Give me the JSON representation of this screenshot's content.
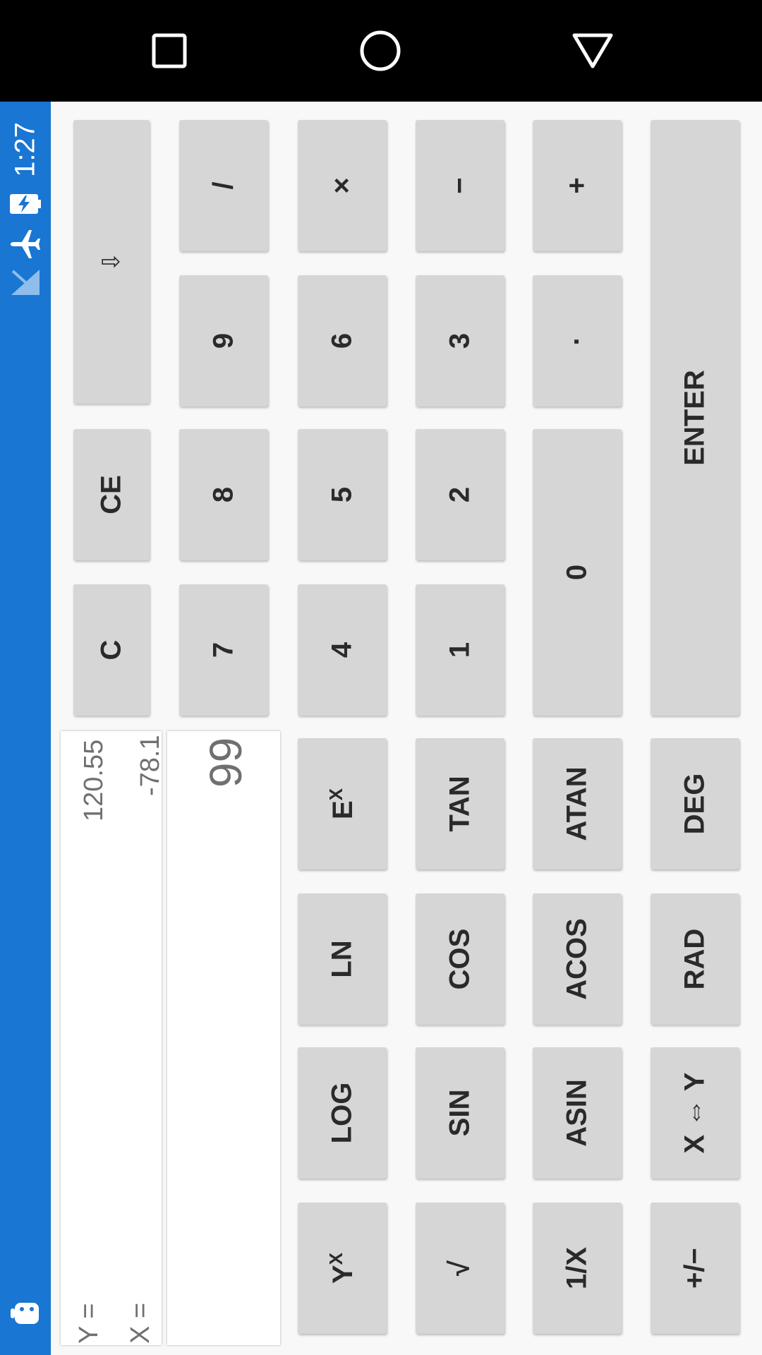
{
  "status_bar": {
    "time": "1:27"
  },
  "display": {
    "y_label": "Y =",
    "y_value": "120.55",
    "x_label": "X =",
    "x_value": "-78.1",
    "input": "99"
  },
  "keys": {
    "backspace": "⇩",
    "ce": "CE",
    "c": "C",
    "divide": "/",
    "multiply": "×",
    "minus": "−",
    "plus": "+",
    "enter": "ENTER",
    "n9": "9",
    "n8": "8",
    "n7": "7",
    "n6": "6",
    "n5": "5",
    "n4": "4",
    "n3": "3",
    "n2": "2",
    "n1": "1",
    "dot": "·",
    "n0": "0",
    "ex_base": "E",
    "ex_sup": "X",
    "ln": "LN",
    "log": "LOG",
    "yx_base": "Y",
    "yx_sup": "X",
    "tan": "TAN",
    "cos": "COS",
    "sin": "SIN",
    "sqrt": "√",
    "atan": "ATAN",
    "acos": "ACOS",
    "asin": "ASIN",
    "recip": "1/X",
    "deg": "DEG",
    "rad": "RAD",
    "swap": "X ⇔ Y",
    "negate": "+/−"
  }
}
